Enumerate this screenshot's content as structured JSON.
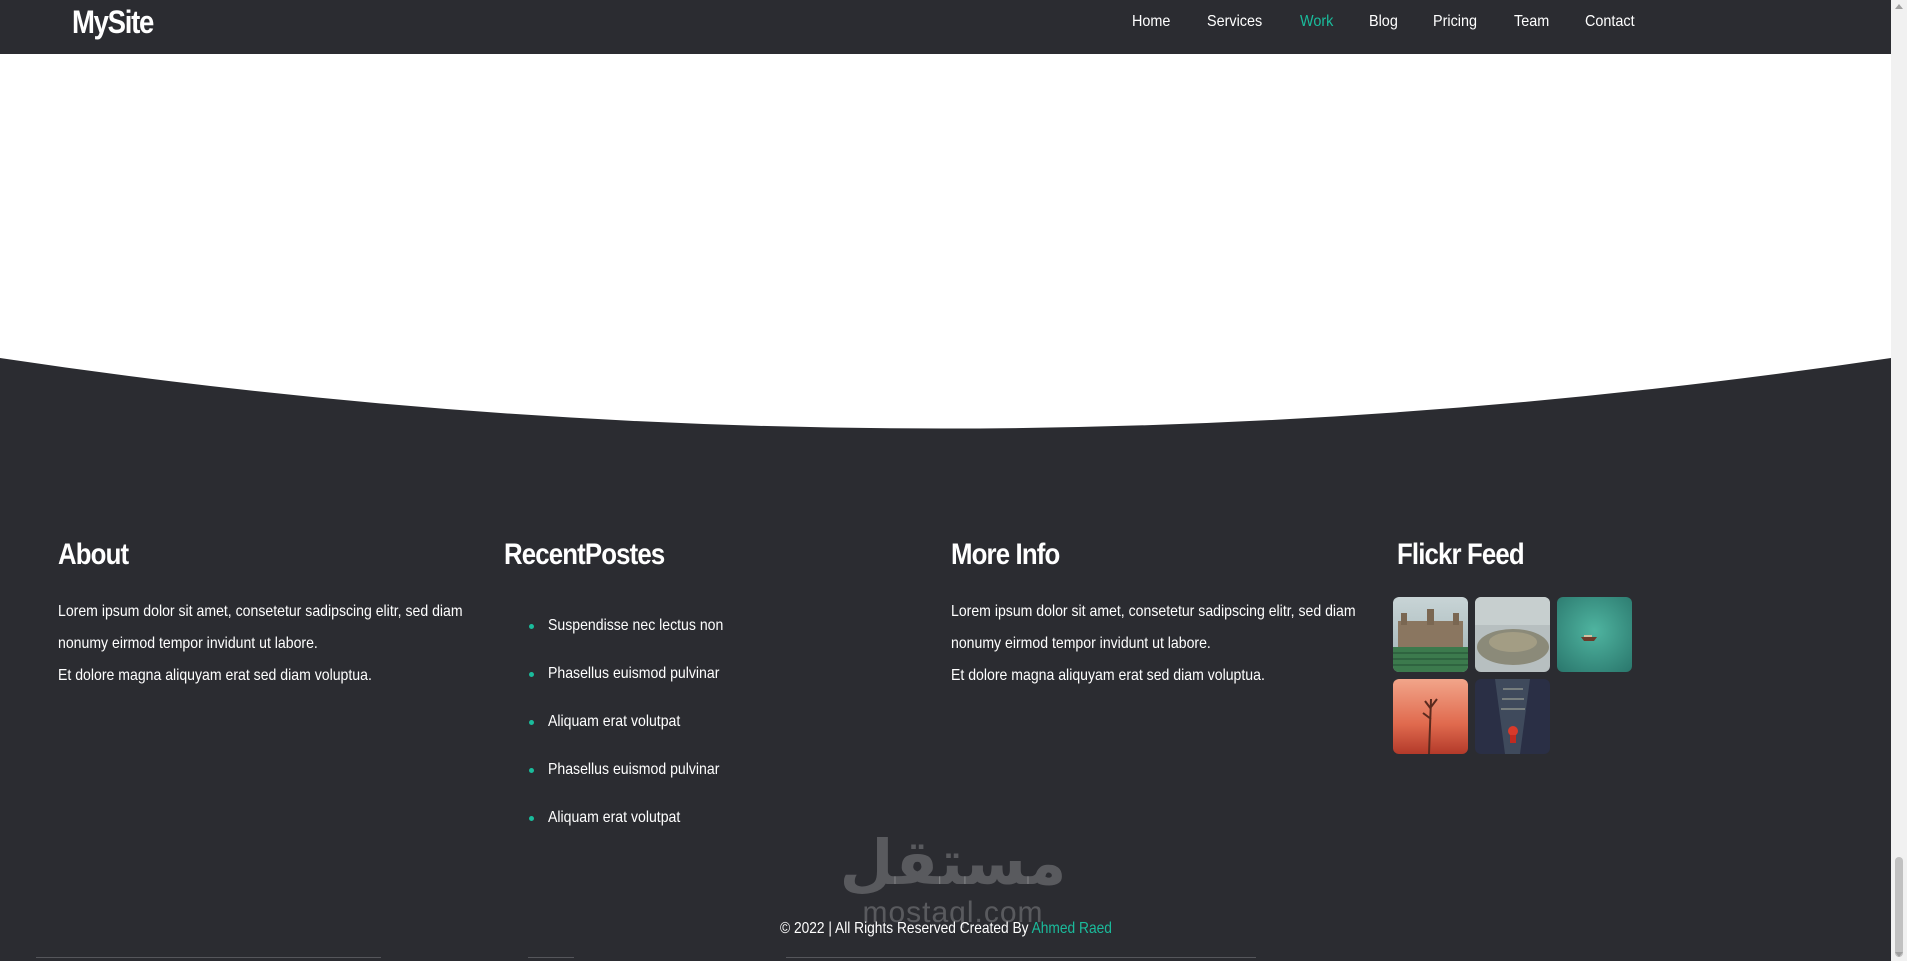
{
  "nav": {
    "logo": "MySite",
    "links": [
      {
        "label": "Home"
      },
      {
        "label": "Services"
      },
      {
        "label": "Work",
        "active": true
      },
      {
        "label": "Blog"
      },
      {
        "label": "Pricing"
      },
      {
        "label": "Team"
      },
      {
        "label": "Contact"
      }
    ]
  },
  "footer": {
    "about": {
      "title": "About",
      "line1": "Lorem ipsum dolor sit amet, consetetur sadipscing elitr, sed diam nonumy eirmod tempor invidunt ut labore.",
      "line2": "Et dolore magna aliquyam erat sed diam voluptua."
    },
    "recent_posts": {
      "title": "RecentPostes",
      "items": [
        "Suspendisse nec lectus non",
        "Phasellus euismod pulvinar",
        "Aliquam erat volutpat",
        "Phasellus euismod pulvinar",
        "Aliquam erat volutpat"
      ]
    },
    "more_info": {
      "title": "More Info",
      "line1": "Lorem ipsum dolor sit amet, consetetur sadipscing elitr, sed diam nonumy eirmod tempor invidunt ut labore.",
      "line2": "Et dolore magna aliquyam erat sed diam voluptua."
    },
    "flickr": {
      "title": "Flickr Feed",
      "images": [
        "castle-image",
        "misty-crowd-image",
        "teal-boat-image",
        "red-grass-image",
        "dark-figure-image"
      ]
    },
    "copyright": {
      "text": "© 2022 | All Rights Reserved Created By ",
      "author": "Ahmed Raed"
    },
    "watermark": {
      "arabic": "مستقل",
      "latin": "mostaql.com"
    }
  },
  "colors": {
    "background_dark": "#2b2c31",
    "accent": "#1abc9c",
    "text": "#ffffff"
  }
}
